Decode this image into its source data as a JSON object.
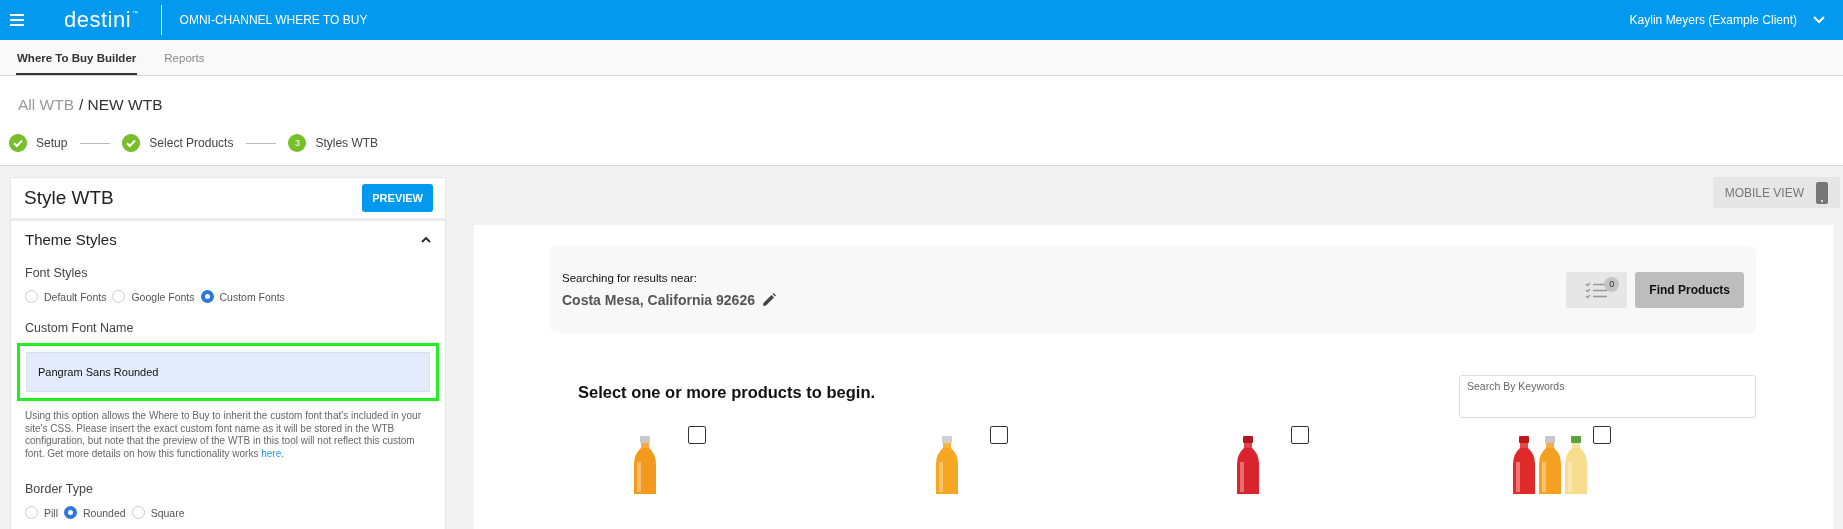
{
  "header": {
    "brand": "destini",
    "brand_mark": "™",
    "app_title": "OMNI-CHANNEL WHERE TO BUY",
    "user": "Kaylin Meyers (Example Client)"
  },
  "nav_tabs": [
    {
      "label": "Where To Buy Builder",
      "selected": true
    },
    {
      "label": "Reports",
      "selected": false
    }
  ],
  "breadcrumb": {
    "parent": "All WTB",
    "current": "/ NEW WTB"
  },
  "steps": [
    {
      "label": "Setup",
      "done": true
    },
    {
      "label": "Select Products",
      "done": true
    },
    {
      "label": "Styles WTB",
      "done": false,
      "number": "3"
    }
  ],
  "style_panel": {
    "title": "Style WTB",
    "preview_button": "PREVIEW",
    "section": {
      "title": "Theme Styles",
      "expanded": true
    },
    "font_styles": {
      "label": "Font Styles",
      "options": [
        {
          "label": "Default Fonts",
          "selected": false
        },
        {
          "label": "Google Fonts",
          "selected": false
        },
        {
          "label": "Custom Fonts",
          "selected": true
        }
      ]
    },
    "custom_font": {
      "label": "Custom Font Name",
      "value": "Pangram Sans Rounded",
      "focused": true,
      "help": "Using this option allows the Where to Buy to inherit the custom font that's included in your site's CSS. Please insert the exact custom font name as it will be stored in the WTB configuration, but note that the preview of the WTB in this tool will not reflect this custom font. Get more details on how this functionality works ",
      "help_link": "here",
      "help_end": "."
    },
    "border_type": {
      "label": "Border Type",
      "options": [
        {
          "label": "Pill",
          "selected": false
        },
        {
          "label": "Rounded",
          "selected": true
        },
        {
          "label": "Square",
          "selected": false
        }
      ]
    }
  },
  "mobile_view_button": "MOBILE VIEW",
  "preview": {
    "search_card": {
      "label": "Searching for results near:",
      "location": "Costa Mesa, California 92626",
      "list_count": "0",
      "find_button": "Find Products"
    },
    "heading": "Select one or more products to begin.",
    "keyword_search": {
      "placeholder": "Search By Keywords"
    },
    "products": [
      {
        "checked": false
      },
      {
        "checked": false
      },
      {
        "checked": false
      },
      {
        "checked": false
      }
    ]
  }
}
